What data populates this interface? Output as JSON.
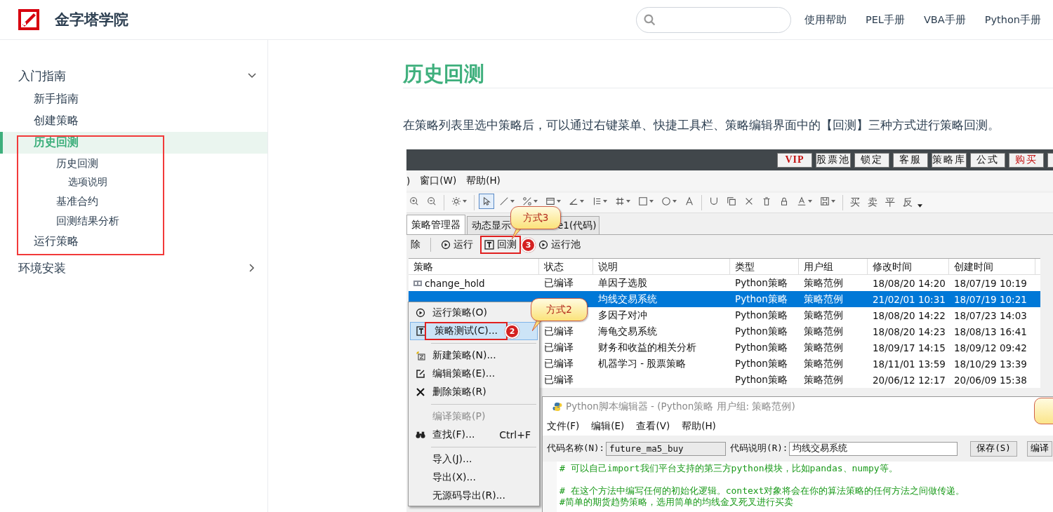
{
  "header": {
    "site_title": "金字塔学院",
    "nav_links": [
      "使用帮助",
      "PEL手册",
      "VBA手册",
      "Python手册"
    ]
  },
  "sidebar": {
    "items": [
      {
        "label": "入门指南",
        "expanded": true,
        "selected": false,
        "children": [
          {
            "label": "新手指南",
            "selected": false,
            "boxed": false
          },
          {
            "label": "创建策略",
            "selected": false,
            "boxed": false
          },
          {
            "label": "历史回测",
            "selected": true,
            "boxed": true,
            "children": [
              {
                "label": "历史回测",
                "selected": false,
                "children": [
                  {
                    "label": "选项说明",
                    "selected": false
                  }
                ]
              },
              {
                "label": "基准合约",
                "selected": false
              },
              {
                "label": "回测结果分析",
                "selected": false
              }
            ]
          },
          {
            "label": "运行策略",
            "selected": false,
            "boxed": true
          }
        ]
      },
      {
        "label": "环境安装",
        "expanded": false,
        "selected": false
      }
    ]
  },
  "article": {
    "title": "历史回测",
    "paragraph": "在策略列表里选中策略后，可以通过右键菜单、快捷工具栏、策略编辑界面中的【回测】三种方式进行策略回测。",
    "screenshot": {
      "top_buttons": [
        {
          "label": "VIP",
          "kind": "accent"
        },
        {
          "label": "股票池",
          "kind": "normal"
        },
        {
          "label": "锁定",
          "kind": "normal"
        },
        {
          "label": "客服",
          "kind": "normal"
        },
        {
          "label": "策略库",
          "kind": "normal"
        },
        {
          "label": "公式",
          "kind": "normal"
        },
        {
          "label": "购买",
          "kind": "warn"
        }
      ],
      "menu": [
        ")",
        "窗口(W)",
        "帮助(H)"
      ],
      "tool_groups": [
        [
          {
            "kind": "zoom-in",
            "selected": false,
            "dropdown": false
          },
          {
            "kind": "zoom-out",
            "selected": false,
            "dropdown": false
          }
        ],
        [
          {
            "kind": "gear",
            "selected": false,
            "dropdown": true
          }
        ],
        [
          {
            "kind": "cursor",
            "selected": true,
            "dropdown": false
          },
          {
            "kind": "line",
            "selected": false,
            "dropdown": true
          },
          {
            "kind": "percent",
            "selected": false,
            "dropdown": true
          },
          {
            "kind": "frame",
            "selected": false,
            "dropdown": true
          },
          {
            "kind": "angle",
            "selected": false,
            "dropdown": true
          },
          {
            "kind": "lines",
            "selected": false,
            "dropdown": true
          },
          {
            "kind": "grid",
            "selected": false,
            "dropdown": true
          },
          {
            "kind": "square",
            "selected": false,
            "dropdown": true
          },
          {
            "kind": "circle",
            "selected": false,
            "dropdown": true
          },
          {
            "kind": "letter",
            "selected": false,
            "dropdown": false
          }
        ],
        [
          {
            "kind": "magnet",
            "selected": false,
            "dropdown": false
          },
          {
            "kind": "copy",
            "selected": false,
            "dropdown": false
          },
          {
            "kind": "cross",
            "selected": false,
            "dropdown": false
          },
          {
            "kind": "trash",
            "selected": false,
            "dropdown": false
          },
          {
            "kind": "lock",
            "selected": false,
            "dropdown": false
          },
          {
            "kind": "font",
            "selected": false,
            "dropdown": true
          },
          {
            "kind": "save",
            "selected": false,
            "dropdown": true
          }
        ]
      ],
      "trade_buttons": [
        "买",
        "卖",
        "平",
        "反"
      ],
      "tabs": [
        {
          "label_parts": [
            "策略管理器"
          ],
          "selected": true
        },
        {
          "label_parts": [
            "动态显示",
            "e1(代码)"
          ],
          "selected": false
        }
      ],
      "actions": [
        {
          "kind": "text",
          "label": "除",
          "boxed": false
        },
        {
          "kind": "run",
          "label": "运行",
          "boxed": false
        },
        {
          "kind": "backtest",
          "label": "回测",
          "boxed": true,
          "badge": "3"
        },
        {
          "kind": "run",
          "label": "运行池",
          "boxed": false
        }
      ],
      "table": {
        "columns": [
          "策略",
          "状态",
          "说明",
          "类型",
          "用户组",
          "修改时间",
          "创建时间"
        ],
        "rows": [
          {
            "selected": false,
            "name": "change_hold",
            "status": "已编译",
            "description": "单因子选股",
            "type": "Python策略",
            "group": "策略范例",
            "modified": "18/08/20 14:20",
            "created": "18/07/19 10:19"
          },
          {
            "selected": true,
            "description": "均线交易系统",
            "type": "Python策略",
            "group": "策略范例",
            "modified": "21/02/01 10:31",
            "created": "18/07/19 10:21"
          },
          {
            "selected": false,
            "description": "多因子对冲",
            "type": "Python策略",
            "group": "策略范例",
            "modified": "18/08/20 14:22",
            "created": "18/07/23 14:03"
          },
          {
            "selected": false,
            "status": "已编译",
            "description": "海龟交易系统",
            "type": "Python策略",
            "group": "策略范例",
            "modified": "18/08/20 14:23",
            "created": "18/08/13 16:41"
          },
          {
            "selected": false,
            "status": "已编译",
            "description": "财务和收益的相关分析",
            "type": "Python策略",
            "group": "策略范例",
            "modified": "18/09/17 14:15",
            "created": "18/09/12 09:42"
          },
          {
            "selected": false,
            "status": "已编译",
            "description": "机器学习 - 股票策略",
            "type": "Python策略",
            "group": "策略范例",
            "modified": "18/11/01 13:59",
            "created": "18/10/29 13:39"
          },
          {
            "selected": false,
            "status": "已编译",
            "type": "Python策略",
            "group": "策略范例",
            "modified": "20/06/12 12:17",
            "created": "20/06/09 15:38"
          }
        ]
      },
      "context_menu": {
        "items": [
          {
            "kind": "item",
            "label": "运行策略(O)",
            "selected": false,
            "disabled": false,
            "boxed": false
          },
          {
            "kind": "item",
            "label": "策略测试(C)...",
            "selected": true,
            "disabled": false,
            "boxed": true,
            "badge": "2"
          },
          {
            "kind": "separator"
          },
          {
            "kind": "item",
            "label": "新建策略(N)...",
            "selected": false,
            "disabled": false,
            "boxed": false
          },
          {
            "kind": "item",
            "label": "编辑策略(E)...",
            "selected": false,
            "disabled": false,
            "boxed": false
          },
          {
            "kind": "item",
            "label": "删除策略(R)",
            "selected": false,
            "disabled": false,
            "boxed": false
          },
          {
            "kind": "separator"
          },
          {
            "kind": "item",
            "label": "编译策略(P)",
            "selected": false,
            "disabled": true,
            "boxed": false
          },
          {
            "kind": "item",
            "label": "查找(F)...",
            "shortcut": "Ctrl+F",
            "selected": false,
            "disabled": false,
            "boxed": false
          },
          {
            "kind": "separator"
          },
          {
            "kind": "item",
            "label": "导入(J)...",
            "selected": false,
            "disabled": false,
            "boxed": false
          },
          {
            "kind": "item",
            "label": "导出(X)...",
            "selected": false,
            "disabled": false,
            "boxed": false
          },
          {
            "kind": "item",
            "label": "无源码导出(R)...",
            "selected": false,
            "disabled": false,
            "boxed": false
          }
        ]
      },
      "callouts": [
        {
          "text": "方式3"
        },
        {
          "text": "方式2"
        }
      ],
      "editor": {
        "title": "Python脚本编辑器 - (Python策略 用户组: 策略范例)",
        "menu": [
          "文件(F)",
          "编辑(E)",
          "查看(V)",
          "帮助(H)"
        ],
        "fields": [
          {
            "label": "代码名称(N):",
            "value": "future_ma5_buy",
            "kind": "readonly"
          },
          {
            "label": "代码说明(R):",
            "value": "均线交易系统",
            "kind": "editable"
          }
        ],
        "buttons": [
          "保存(S)",
          "编译"
        ],
        "code_blocks": [
          [
            "# 可以自己import我们平台支持的第三方python模块，比如pandas、numpy等。"
          ],
          [
            "# 在这个方法中编写任何的初始化逻辑。context对象将会在你的算法策略的任何方法之间做传递。",
            "#简单的期货趋势策略，选用简单的均线金叉死叉进行买卖"
          ]
        ]
      }
    }
  }
}
